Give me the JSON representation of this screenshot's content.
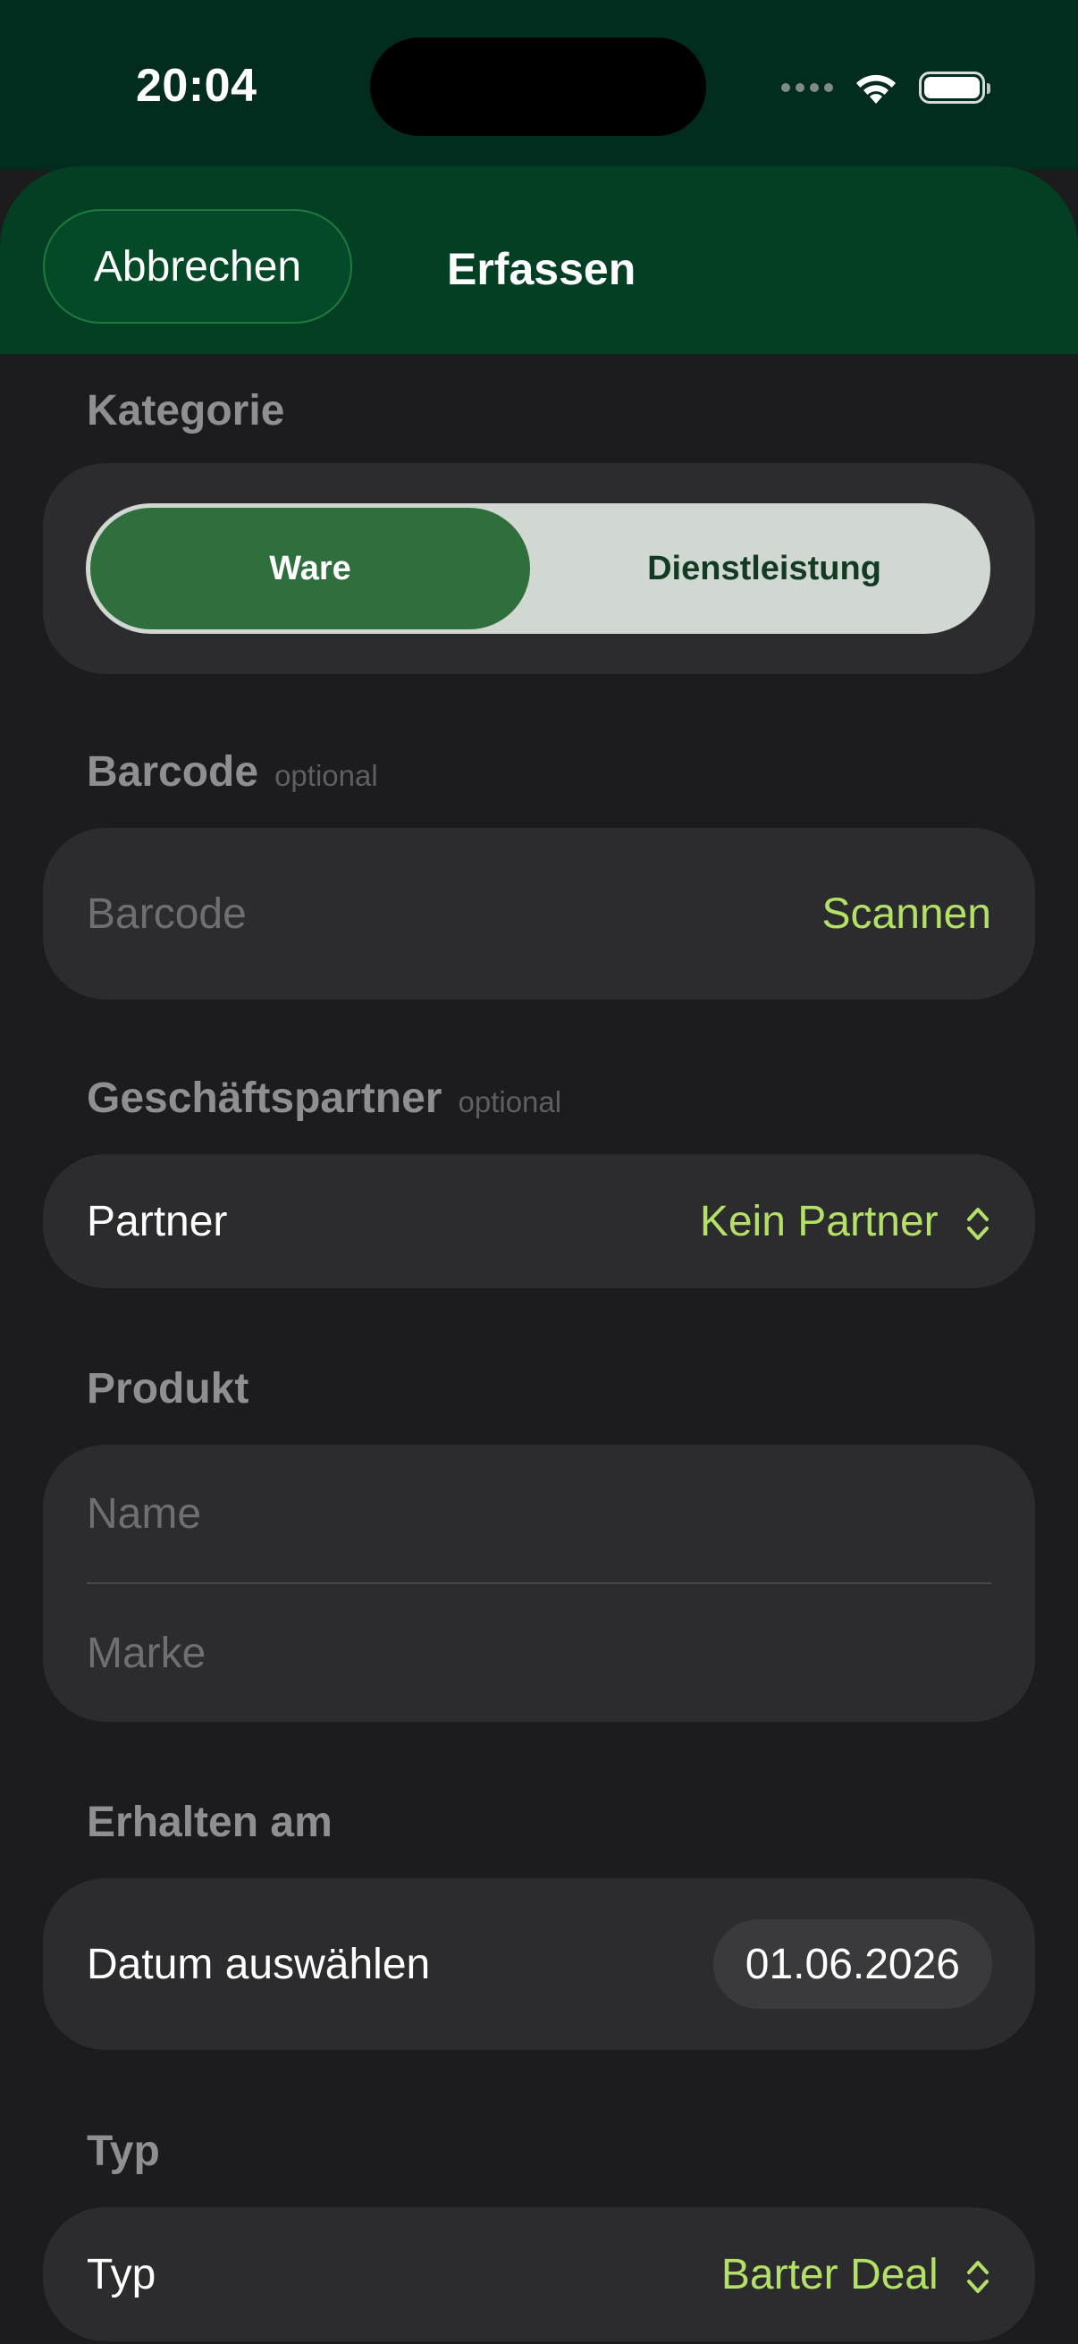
{
  "status_bar": {
    "time": "20:04",
    "icons": [
      "cellular-dots-icon",
      "wifi-icon",
      "battery-icon"
    ]
  },
  "header": {
    "cancel_label": "Abbrechen",
    "title": "Erfassen"
  },
  "kategorie": {
    "label": "Kategorie",
    "options": [
      "Ware",
      "Dienstleistung"
    ],
    "selected": "Ware"
  },
  "barcode": {
    "label": "Barcode",
    "optional_label": "optional",
    "placeholder": "Barcode",
    "scan_label": "Scannen"
  },
  "partner": {
    "label": "Geschäftspartner",
    "optional_label": "optional",
    "row_label": "Partner",
    "value": "Kein Partner"
  },
  "produkt": {
    "label": "Produkt",
    "name_placeholder": "Name",
    "brand_placeholder": "Marke"
  },
  "erhalten": {
    "label": "Erhalten am",
    "row_label": "Datum auswählen",
    "date": "01.06.2026"
  },
  "typ": {
    "label": "Typ",
    "row_label": "Typ",
    "value": "Barter Deal"
  },
  "colors": {
    "accent": "#b3e066",
    "header_green": "#033f23",
    "selected_segment": "#2f6f3e",
    "background": "#1c1c1e",
    "card": "#2c2c2e"
  }
}
